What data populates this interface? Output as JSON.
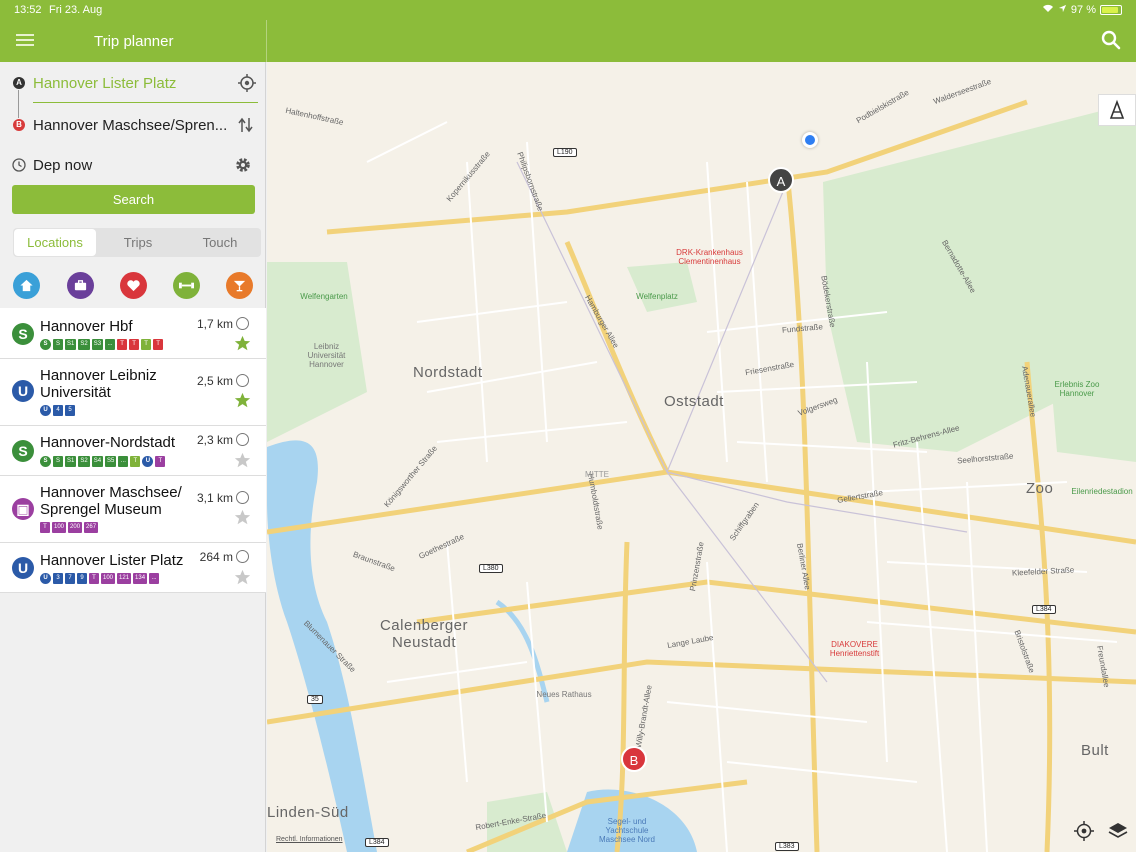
{
  "status": {
    "time": "13:52",
    "date": "Fri 23. Aug",
    "battery": "97 %"
  },
  "header": {
    "title": "Trip planner"
  },
  "trip": {
    "from_pin": "A",
    "to_pin": "B",
    "from": "Hannover Lister Platz",
    "to": "Hannover Maschsee/Spren...",
    "departure": "Dep now",
    "search_label": "Search"
  },
  "tabs": [
    {
      "label": "Locations"
    },
    {
      "label": "Trips"
    },
    {
      "label": "Touch"
    }
  ],
  "categories": [
    {
      "icon": "home-icon",
      "color": "#3aa0d8"
    },
    {
      "icon": "briefcase-icon",
      "color": "#6a3f9a"
    },
    {
      "icon": "heart-icon",
      "color": "#d9363c"
    },
    {
      "icon": "dumbbell-icon",
      "color": "#7fb23a"
    },
    {
      "icon": "cocktail-icon",
      "color": "#e87a2a"
    }
  ],
  "locations": [
    {
      "name": "Hannover Hbf",
      "distance": "1,7 km",
      "type": "S",
      "favorite": true,
      "lines": [
        "S",
        "S",
        "S1",
        "S2",
        "S3",
        "...",
        "T",
        "T",
        "T",
        "T"
      ]
    },
    {
      "name": "Hannover Leibniz Universität",
      "distance": "2,5 km",
      "type": "U",
      "favorite": true,
      "lines": [
        "U",
        "4",
        "5"
      ]
    },
    {
      "name": "Hannover-Nordstadt",
      "distance": "2,3 km",
      "type": "S",
      "favorite": false,
      "lines": [
        "S",
        "S",
        "S1",
        "S2",
        "S4",
        "S5",
        "...",
        "T",
        "U",
        "T"
      ]
    },
    {
      "name": "Hannover Maschsee/ Sprengel Museum",
      "distance": "3,1 km",
      "type": "B",
      "favorite": false,
      "lines": [
        "T",
        "100",
        "200",
        "267"
      ]
    },
    {
      "name": "Hannover Lister Platz",
      "distance": "264 m",
      "type": "U",
      "favorite": false,
      "lines": [
        "U",
        "3",
        "7",
        "9",
        "T",
        "100",
        "121",
        "134",
        "..."
      ]
    }
  ],
  "map": {
    "districts": [
      "Nordstadt",
      "Oststadt",
      "Calenberger Neustadt",
      "Zoo",
      "Bult",
      "Linden-Süd"
    ],
    "streets": [
      "Haltenhoffstraße",
      "Kopernikusstraße",
      "Philipsbornstraße",
      "Hamburger Allee",
      "Bödekerstraße",
      "Podbielskistraße",
      "Waldersee­straße",
      "Bernadotte-Allee",
      "Adenauerallee",
      "Berliner Allee",
      "Schiffgraben",
      "Goethestraße",
      "Braunstraße",
      "Prinzenstraße",
      "Willy-Brandt-Allee",
      "Robert-Enke-Straße",
      "Fritz-Behrens-Allee",
      "Seelhorststraße",
      "Bristolstraße",
      "Freundallee",
      "Lange Laube",
      "Humboldtstraße",
      "Königsworther Straße",
      "Blumenauer Straße",
      "Fundstraße",
      "Friesenstraße",
      "Volgersweg",
      "Gellertstraße",
      "Kleefelder Straße"
    ],
    "pois": [
      "Welfengarten",
      "Leibniz Universität Hannover",
      "DRK-Krankenhaus Clementinenhaus",
      "Welfenplatz",
      "Erlebnis Zoo Hannover",
      "Eilenriedestadion",
      "DIAKOVERE Henriettenstift",
      "Neues Rathaus",
      "Segel- und Yachtschule Maschsee Nord",
      "MITTE"
    ],
    "road_shields": [
      "L190",
      "L380",
      "L384",
      "L384",
      "35",
      "L383"
    ],
    "marker_a": "A",
    "marker_b": "B",
    "legal": "Rechtl. Informationen"
  }
}
